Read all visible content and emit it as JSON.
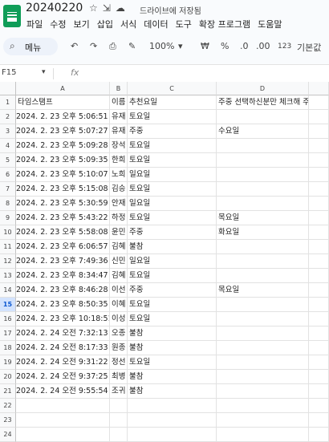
{
  "app": {
    "doc_title": "20240220",
    "save_status": "드라이브에 저장됨",
    "menu": [
      "파일",
      "수정",
      "보기",
      "삽입",
      "서식",
      "데이터",
      "도구",
      "확장 프로그램",
      "도움말"
    ],
    "title_icons": [
      "star-icon",
      "move-icon",
      "cloud-icon"
    ]
  },
  "toolbar": {
    "search_label": "메뉴",
    "zoom": "100%",
    "currency": "₩",
    "percent": "%",
    "dec_decrease": ".0",
    "dec_increase": ".00",
    "number_format": "123",
    "font_default": "기본값"
  },
  "formula_bar": {
    "name_box": "F15",
    "fx": "fx",
    "content": ""
  },
  "sheet": {
    "columns": [
      "A",
      "B",
      "C",
      "D"
    ],
    "row_numbers": [
      "1",
      "2",
      "3",
      "4",
      "5",
      "6",
      "7",
      "8",
      "9",
      "10",
      "11",
      "12",
      "13",
      "14",
      "15",
      "16",
      "17",
      "18",
      "19",
      "20",
      "21",
      "22",
      "23",
      "24"
    ],
    "selected_row": "15",
    "rows": [
      [
        "타임스탬프",
        "이름",
        "추천요일",
        "주중 선택하신분만 체크해 주세요"
      ],
      [
        "2024. 2. 23 오후 5:06:51",
        "유재",
        "토요일",
        ""
      ],
      [
        "2024. 2. 23 오후 5:07:27",
        "유재",
        "주중",
        "수요일"
      ],
      [
        "2024. 2. 23 오후 5:09:28",
        "장석",
        "토요일",
        ""
      ],
      [
        "2024. 2. 23 오후 5:09:35",
        "한희",
        "토요일",
        ""
      ],
      [
        "2024. 2. 23 오후 5:10:07",
        "노희",
        "일요일",
        ""
      ],
      [
        "2024. 2. 23 오후 5:15:08",
        "김승",
        "토요일",
        ""
      ],
      [
        "2024. 2. 23 오후 5:30:59",
        "안재",
        "일요일",
        ""
      ],
      [
        "2024. 2. 23 오후 5:43:22",
        "하정",
        "토요일",
        "목요일"
      ],
      [
        "2024. 2. 23 오후 5:58:08",
        "윤민",
        "주중",
        "화요일"
      ],
      [
        "2024. 2. 23 오후 6:06:57",
        "김혜",
        "불참",
        ""
      ],
      [
        "2024. 2. 23 오후 7:49:36",
        "신민",
        "일요일",
        ""
      ],
      [
        "2024. 2. 23 오후 8:34:47",
        "김혜",
        "토요일",
        ""
      ],
      [
        "2024. 2. 23 오후 8:46:28",
        "이선",
        "주중",
        "목요일"
      ],
      [
        "2024. 2. 23 오후 8:50:35",
        "이혜",
        "토요일",
        ""
      ],
      [
        "2024. 2. 23 오후 10:18:51",
        "이성",
        "토요일",
        ""
      ],
      [
        "2024. 2. 24 오전 7:32:13",
        "오종",
        "불참",
        ""
      ],
      [
        "2024. 2. 24 오전 8:17:33",
        "원종",
        "불참",
        ""
      ],
      [
        "2024. 2. 24 오전 9:31:22",
        "정선",
        "토요일",
        ""
      ],
      [
        "2024. 2. 24 오전 9:37:25",
        "최병",
        "불참",
        ""
      ],
      [
        "2024. 2. 24 오전 9:55:54",
        "조귀",
        "불참",
        ""
      ],
      [
        "",
        "",
        "",
        ""
      ],
      [
        "",
        "",
        "",
        ""
      ],
      [
        "",
        "",
        "",
        ""
      ]
    ]
  }
}
